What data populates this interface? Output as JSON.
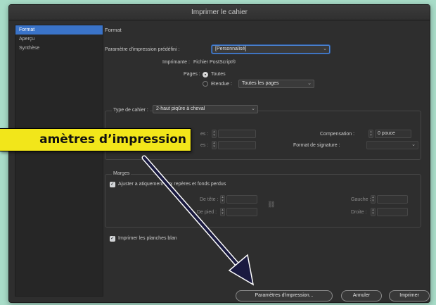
{
  "window": {
    "title": "Imprimer le cahier"
  },
  "sidebar": {
    "items": [
      {
        "label": "Format",
        "active": true
      },
      {
        "label": "Aperçu",
        "active": false
      },
      {
        "label": "Synthèse",
        "active": false
      }
    ]
  },
  "main": {
    "section_title": "Format",
    "preset_label": "Paramètre d'impression prédéfini :",
    "preset_value": "[Personnalisé]",
    "printer_label": "Imprimante :",
    "printer_value": "Fichier PostScript®",
    "pages_label": "Pages :",
    "pages_all": "Toutes",
    "pages_range": "Etendue :",
    "pages_range_value": "Toutes les pages",
    "booklet_type_label": "Type de cahier :",
    "booklet_type_value": "2-haut piqûre à cheval",
    "field_a_suffix": "es :",
    "field_b_suffix": "es :",
    "compensation_label": "Compensation :",
    "compensation_value": "0 pouce",
    "signature_label": "Format de signature :",
    "margins_title": "Marges",
    "margins_auto": "Ajuster a     atiquement aux repères et fonds perdus",
    "top_label": "De tête :",
    "bottom_label": "De pied :",
    "left_label": "Gauche :",
    "right_label": "Droite :",
    "blank_pages": "Imprimer les planches blan"
  },
  "buttons": {
    "print_settings": "Paramètres d'impression...",
    "cancel": "Annuler",
    "print": "Imprimer"
  },
  "callout": {
    "text": "amètres d’impression"
  },
  "colors": {
    "accent": "#3a73c8",
    "callout_bg": "#f2e61a",
    "arrow": "#1a1a40"
  },
  "icons": {
    "dropdown": "chevron-down-icon",
    "link": "chain-icon"
  }
}
